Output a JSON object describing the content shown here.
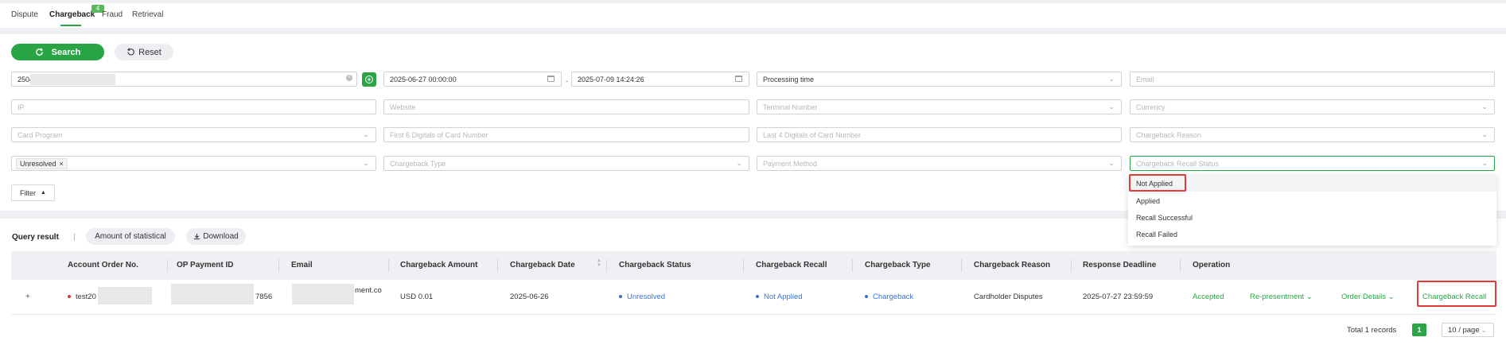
{
  "tabs": [
    {
      "label": "Dispute"
    },
    {
      "label": "Chargeback",
      "badge": "4"
    },
    {
      "label": "Fraud"
    },
    {
      "label": "Retrieval"
    }
  ],
  "actions": {
    "search_label": "Search",
    "reset_label": "Reset"
  },
  "filters": {
    "order_value": "2504",
    "start_date": "2025-06-27 00:00:00",
    "date_separator": "-",
    "end_date": "2025-07-09 14:24:26",
    "time_type": "Processing time",
    "email": "Email",
    "ip": "IP",
    "website": "Website",
    "terminal_number": "Terminal Number",
    "currency": "Currency",
    "card_program": "Card Program",
    "first6": "First 6 Digitals of Card Number",
    "last4": "Last 4 Digitals of Card Number",
    "chargeback_reason": "Chargeback Reason",
    "status_tag": "Unresolved",
    "chargeback_type": "Chargeback Type",
    "payment_method": "Payment Method",
    "recall_status": "Chargeback Recall Status",
    "filter_toggle": "Filter"
  },
  "recall_status_options": [
    "Not Applied",
    "Applied",
    "Recall Successful",
    "Recall Failed"
  ],
  "results": {
    "title": "Query result",
    "separator": "|",
    "statistical_label": "Amount of statistical",
    "download_label": "Download"
  },
  "table": {
    "headers": {
      "account_order": "Account Order No.",
      "op_payment": "OP Payment ID",
      "email": "Email",
      "amount": "Chargeback Amount",
      "date": "Chargeback Date",
      "status": "Chargeback Status",
      "recall": "Chargeback Recall",
      "type": "Chargeback Type",
      "reason": "Chargeback Reason",
      "deadline": "Response Deadline",
      "operation": "Operation"
    },
    "row": {
      "expand": "+",
      "account_order": "test20",
      "op_payment_suffix": "7856",
      "email_suffix": "ment.co",
      "amount": "USD 0.01",
      "date": "2025-06-26",
      "status": "Unresolved",
      "recall": "Not Applied",
      "type": "Chargeback",
      "reason": "Cardholder Disputes",
      "deadline": "2025-07-27 23:59:59",
      "op_accepted": "Accepted",
      "op_representment": "Re-presentment",
      "op_order_details": "Order Details",
      "op_recall": "Chargeback Recall"
    }
  },
  "pagination": {
    "total": "Total 1 records",
    "page": "1",
    "page_size": "10 / page"
  },
  "colors": {
    "accent": "#2aa546",
    "link": "#3a72d8",
    "status_dot": "#e53935",
    "highlight_box": "#e53935"
  }
}
